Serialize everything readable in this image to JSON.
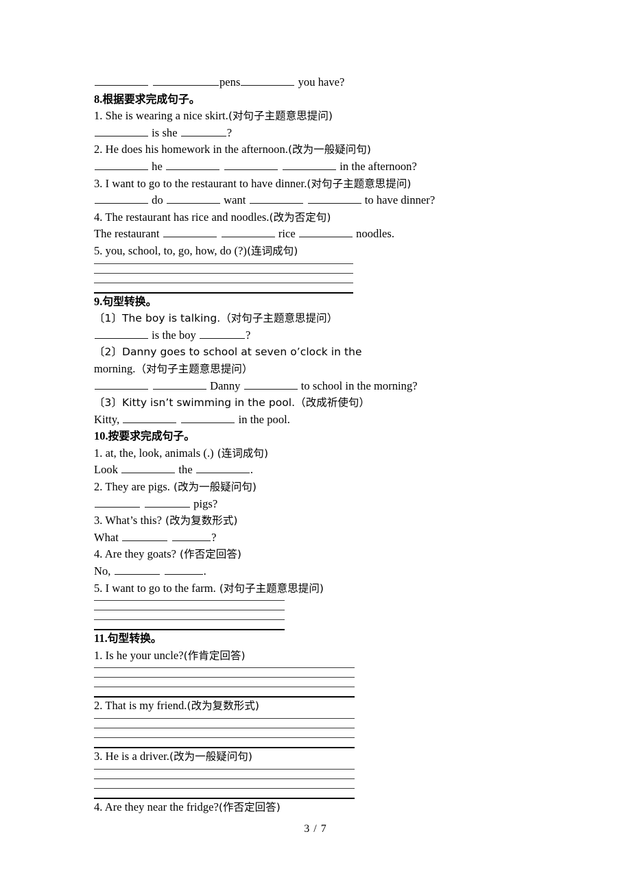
{
  "document": {
    "page_label": "3 / 7"
  },
  "top_line": {
    "text_after_blanks": "pens",
    "tail": " you have?"
  },
  "sections": [
    {
      "id": "8",
      "number": "8.",
      "title_cn": "根据要求完成句子。",
      "items": [
        {
          "prompt": "1. She is wearing a nice skirt.",
          "instruction": "(对句子主题意思提问)",
          "answer_line": {
            "segments": [
              "",
              " is she ",
              "?"
            ]
          }
        },
        {
          "prompt": "2. He does his homework in the afternoon.",
          "instruction": "(改为一般疑问句)",
          "answer_line": {
            "segments": [
              "",
              " he ",
              " ",
              " ",
              " in the afternoon?"
            ]
          }
        },
        {
          "prompt": "3. I want to go to the restaurant to have dinner.",
          "instruction": "(对句子主题意思提问)",
          "answer_line": {
            "segments": [
              "",
              " do ",
              " want ",
              " ",
              " to have dinner?"
            ]
          }
        },
        {
          "prompt": "4. The restaurant has rice and noodles.",
          "instruction": "(改为否定句)",
          "answer_line": {
            "segments": [
              "The restaurant ",
              " ",
              " rice ",
              " noodles."
            ]
          }
        },
        {
          "prompt": "5. you, school, to, go, how, do (?)",
          "instruction": "(连词成句)",
          "rule_lines": 4
        }
      ]
    },
    {
      "id": "9",
      "number": "9.",
      "title_cn": "句型转换。",
      "items": [
        {
          "prompt": "〔1〕The boy is talking.",
          "instruction": "（对句子主题意思提问）",
          "answer_line": {
            "segments": [
              "",
              " is the boy ",
              "?"
            ]
          }
        },
        {
          "prompt": "〔2〕Danny goes to school at seven o’clock in the",
          "prompt_cont": "morning.",
          "instruction": "（对句子主题意思提问）",
          "answer_line": {
            "segments": [
              "",
              " ",
              " Danny ",
              " to school in the morning?"
            ]
          }
        },
        {
          "prompt": "〔3〕Kitty isn’t swimming in the pool.",
          "instruction": "（改成祈使句）",
          "answer_line": {
            "segments": [
              "Kitty, ",
              " ",
              " in the pool."
            ]
          }
        }
      ]
    },
    {
      "id": "10",
      "number": "10.",
      "title_cn": "按要求完成句子。",
      "items": [
        {
          "prompt": "1. at, the, look, animals (.)",
          "instruction": "(连词成句)",
          "answer_line": {
            "segments": [
              "Look ",
              " the ",
              "."
            ]
          }
        },
        {
          "prompt": "2. They are pigs.",
          "instruction": "(改为一般疑问句)",
          "answer_line": {
            "segments": [
              "",
              " ",
              " pigs?"
            ]
          }
        },
        {
          "prompt": "3. What’s this?",
          "instruction": "(改为复数形式)",
          "answer_line": {
            "segments": [
              "What ",
              " ",
              "?"
            ]
          }
        },
        {
          "prompt": "4. Are they goats?",
          "instruction": "(作否定回答)",
          "answer_line": {
            "segments": [
              "No, ",
              " ",
              "."
            ]
          }
        },
        {
          "prompt": "5. I want to go to the farm.",
          "instruction": "(对句子主题意思提问)",
          "rule_lines": 4
        }
      ]
    },
    {
      "id": "11",
      "number": "11.",
      "title_cn": "句型转换。",
      "items": [
        {
          "prompt": "1. Is he your uncle?",
          "instruction": "(作肯定回答)",
          "rule_lines": 4
        },
        {
          "prompt": "2. That is my friend.",
          "instruction": "(改为复数形式)",
          "rule_lines": 4
        },
        {
          "prompt": "3. He is a driver.",
          "instruction": "(改为一般疑问句)",
          "rule_lines": 4
        },
        {
          "prompt": "4. Are they near the fridge?",
          "instruction": "(作否定回答)"
        }
      ]
    }
  ]
}
